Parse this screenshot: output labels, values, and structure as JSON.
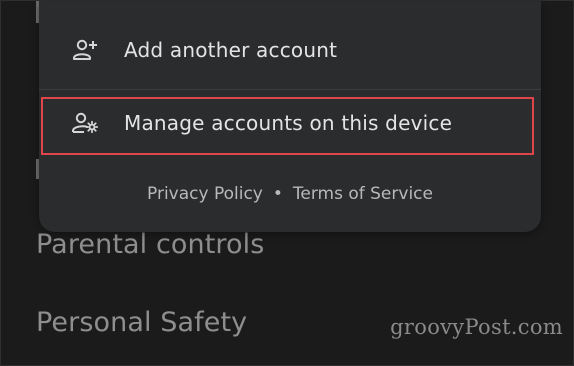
{
  "account_menu": {
    "add_account_label": "Add another account",
    "add_account_icon": "person-add-icon",
    "manage_accounts_label": "Manage accounts on this device",
    "manage_accounts_icon": "manage-accounts-icon",
    "privacy_policy_label": "Privacy Policy",
    "separator": "•",
    "terms_label": "Terms of Service"
  },
  "settings_list": {
    "items": [
      "Parental controls",
      "Personal Safety"
    ]
  },
  "annotation": {
    "highlight_color": "#e0454c"
  },
  "watermark": "groovyPost.com"
}
